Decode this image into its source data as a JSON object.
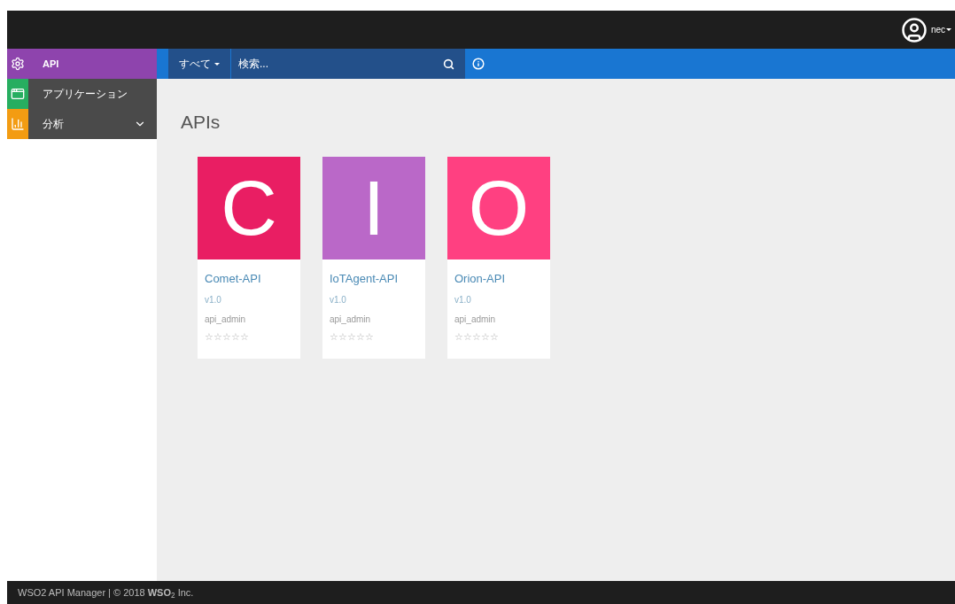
{
  "user": {
    "name": "nec"
  },
  "sidebar": {
    "items": [
      {
        "label": "API",
        "kind": "api",
        "selected": true,
        "color": "#8e44ad"
      },
      {
        "label": "アプリケーション",
        "kind": "apps",
        "selected": false,
        "color": "#27ae60"
      },
      {
        "label": "分析",
        "kind": "analytics",
        "selected": false,
        "color": "#f39c12",
        "expanded": false
      }
    ]
  },
  "search": {
    "scope": "すべて",
    "placeholder": "検索..."
  },
  "page_title": "APIs",
  "apis": [
    {
      "letter": "C",
      "color": "#e91e63",
      "name": "Comet-API",
      "version": "v1.0",
      "owner": "api_admin",
      "stars": 0
    },
    {
      "letter": "I",
      "color": "#ba68c8",
      "name": "IoTAgent-API",
      "version": "v1.0",
      "owner": "api_admin",
      "stars": 0
    },
    {
      "letter": "O",
      "color": "#ff4081",
      "name": "Orion-API",
      "version": "v1.0",
      "owner": "api_admin",
      "stars": 0
    }
  ],
  "footer": "WSO2 API Manager | © 2018 **WSO**$_{2}$ Inc."
}
